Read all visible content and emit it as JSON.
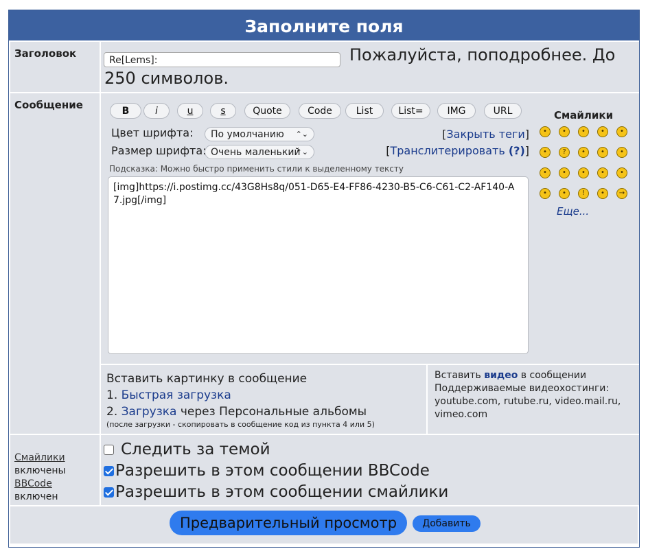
{
  "header": {
    "title": "Заполните поля"
  },
  "subject": {
    "label": "Заголовок",
    "value": "Re[Lems]:",
    "hint": "Пожалуйста, поподробнее. До 250 символов."
  },
  "message": {
    "label": "Сообщение",
    "toolbar": [
      "B",
      "i",
      "u",
      "s",
      "Quote",
      "Code",
      "List",
      "List=",
      "IMG",
      "URL"
    ],
    "font_color_label": "Цвет шрифта:",
    "font_color_value": "По умолчанию",
    "font_size_label": "Размер шрифта:",
    "font_size_value": "Очень маленький",
    "close_tags_link": "Закрыть теги",
    "translit_link": "Транслитерировать",
    "translit_help": "(?)",
    "hint": "Подсказка: Можно быстро применить стили к выделенному тексту",
    "body": "[img]https://i.postimg.cc/43G8Hs8q/051-D65-E4-FF86-4230-B5-C6-C61-C2-AF140-A7.jpg[/img]"
  },
  "smilies": {
    "title": "Смайлики",
    "more": "Еще...",
    "icons": [
      "grin-smiley-icon",
      "smile-smiley-icon",
      "sad-smiley-icon",
      "blush-smiley-icon",
      "shock-smiley-icon",
      "glasses-smiley-icon",
      "question-smiley-icon",
      "confused-smiley-icon",
      "cool-smiley-icon",
      "laugh-smiley-icon",
      "mad-smiley-icon",
      "tongue-smiley-icon",
      "frown-smiley-icon",
      "evil-smiley-icon",
      "devil-smiley-icon",
      "shades-smiley-icon",
      "wink-smiley-icon",
      "exclaim-smiley-icon",
      "idea-smiley-icon",
      "arrow-smiley-icon"
    ],
    "glyphs": [
      "D",
      ")",
      "(",
      "o",
      "O",
      "8",
      "?",
      "/",
      "B",
      "D",
      "&gt;",
      "P",
      "(",
      ">",
      "&gt;",
      "B",
      ";",
      "!",
      "i",
      "→"
    ]
  },
  "insert_image": {
    "title": "Вставить картинку в сообщение",
    "item1_num": "1.",
    "item1_link": "Быстрая загрузка",
    "item2_num": "2.",
    "item2_link": "Загрузка",
    "item2_rest": "через Персональные альбомы",
    "note": "(после загрузки - скопировать в сообщение код из пункта 4 или 5)"
  },
  "insert_video": {
    "prefix": "Вставить",
    "bold": "видео",
    "suffix": "в сообщении",
    "hosts_label": "Поддерживаемые видеохостинги:",
    "hosts": "youtube.com, rutube.ru, video.mail.ru, vimeo.com"
  },
  "options_left": {
    "smilies_link": "Смайлики",
    "smilies_state": "включены",
    "bbcode_link": "BBCode",
    "bbcode_state": "включен"
  },
  "options": [
    {
      "label": "Следить за темой",
      "checked": false
    },
    {
      "label": "Разрешить в этом сообщении BBCode",
      "checked": true
    },
    {
      "label": "Разрешить в этом сообщении смайлики",
      "checked": true
    }
  ],
  "buttons": {
    "preview": "Предварительный просмотр",
    "submit": "Добавить"
  },
  "colors": {
    "header_bg": "#3c61a0",
    "cell_bg": "#dfe2e8",
    "button_blue": "#2f7bee",
    "link": "#1a3b8c"
  }
}
